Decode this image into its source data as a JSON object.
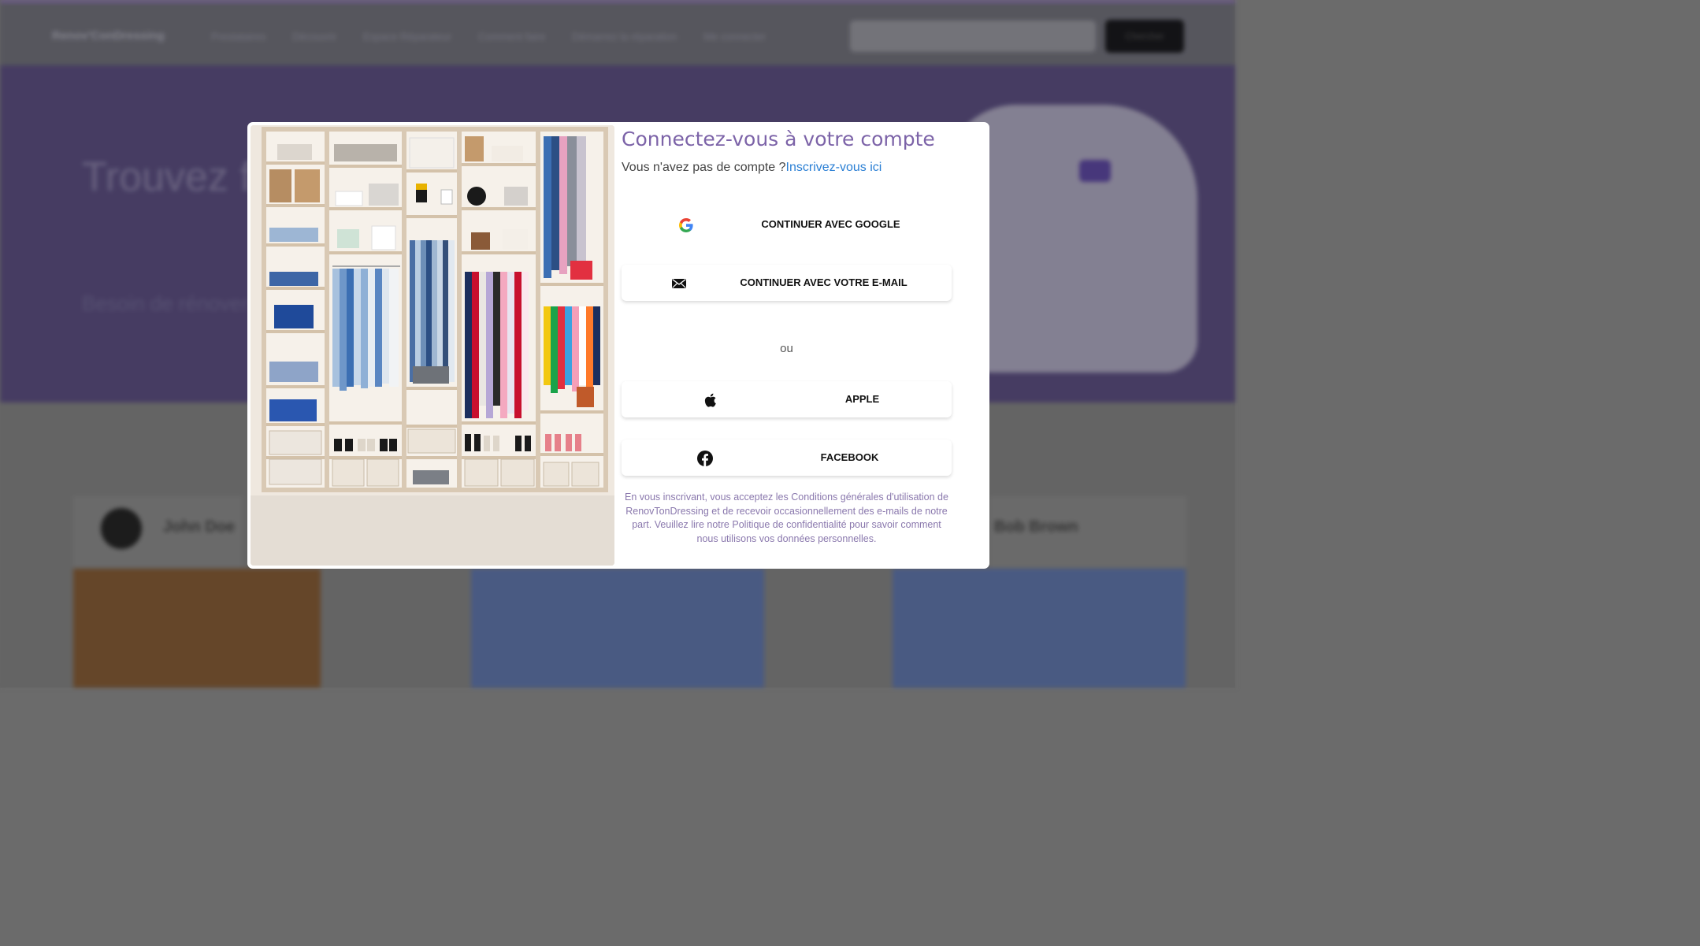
{
  "background": {
    "brand": "Renov'ConDressing",
    "nav_links": [
      "Prestataires",
      "Découvrir",
      "Espace Réparateur",
      "Comment faire",
      "Démarrez la réparation",
      "Me connecter"
    ],
    "search_button": "Chercher",
    "hero_title": "Trouvez facilement",
    "hero_subtitle": "Besoin de rénover ? Trouvez votre prestataire ICI",
    "users": [
      "John Doe",
      "Bob Brown"
    ]
  },
  "modal": {
    "title": "Connectez-vous à votre compte",
    "no_account": "Vous n'avez pas de compte ?",
    "signup_link": "Inscrivez-vous ici",
    "google_label": "CONTINUER AVEC GOOGLE",
    "email_label": "CONTINUER AVEC VOTRE E-MAIL",
    "or": "ou",
    "apple_label": "APPLE",
    "facebook_label": "FACEBOOK",
    "legal": "En vous inscrivant, vous acceptez les Conditions générales d'utilisation de RenovTonDressing et de recevoir occasionnellement des e-mails de notre part. Veuillez lire notre Politique de confidentialité pour savoir comment nous utilisons vos données personnelles."
  },
  "colors": {
    "title": "#7c63a8",
    "link": "#2a7fd4",
    "legal": "#8a78ad",
    "hero_bg": "#4a4068"
  },
  "icons": [
    "google-icon",
    "mail-icon",
    "apple-icon",
    "facebook-icon"
  ]
}
